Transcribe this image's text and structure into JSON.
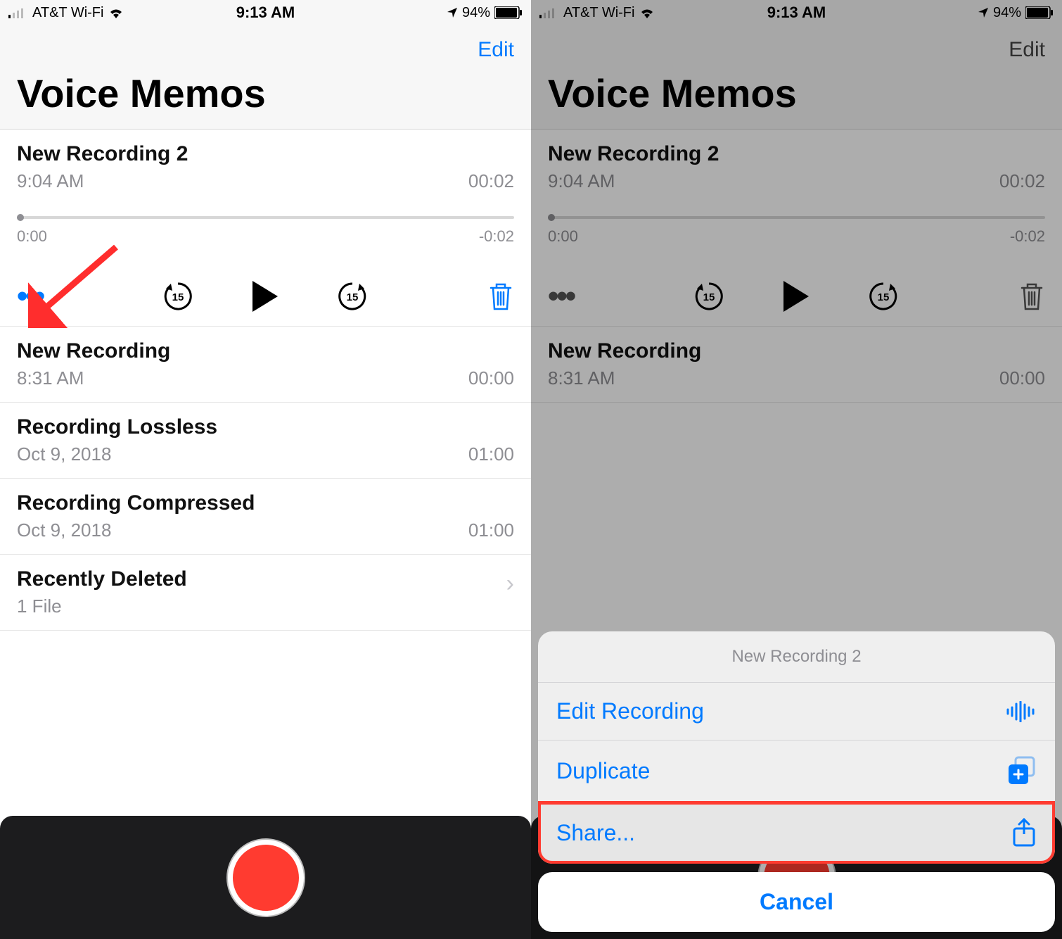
{
  "statusbar": {
    "carrier": "AT&T Wi-Fi",
    "time": "9:13 AM",
    "battery_pct": "94%"
  },
  "nav": {
    "title": "Voice Memos",
    "edit": "Edit"
  },
  "current": {
    "title": "New Recording 2",
    "time": "9:04 AM",
    "duration": "00:02",
    "elapsed": "0:00",
    "remaining": "-0:02"
  },
  "recordings": [
    {
      "title": "New Recording",
      "time": "8:31 AM",
      "duration": "00:00"
    },
    {
      "title": "Recording Lossless",
      "time": "Oct 9, 2018",
      "duration": "01:00"
    },
    {
      "title": "Recording Compressed",
      "time": "Oct 9, 2018",
      "duration": "01:00"
    }
  ],
  "deleted": {
    "label": "Recently Deleted",
    "sub": "1 File"
  },
  "sheet": {
    "title": "New Recording 2",
    "edit": "Edit Recording",
    "duplicate": "Duplicate",
    "share": "Share...",
    "cancel": "Cancel"
  },
  "icons": {
    "skip_back": "15",
    "skip_fwd": "15"
  }
}
